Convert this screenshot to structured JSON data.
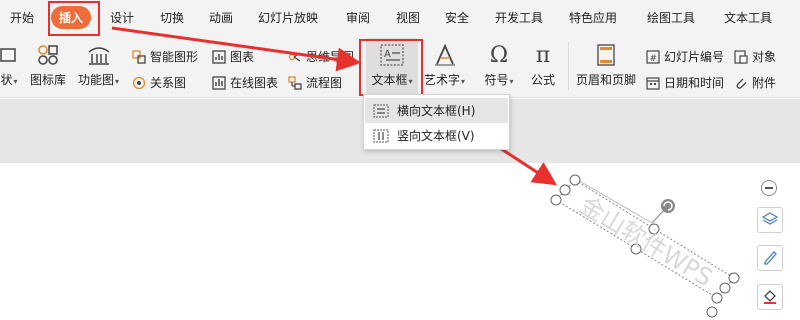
{
  "menu": {
    "tabs": [
      {
        "label": "开始"
      },
      {
        "label": "插入",
        "active": true
      },
      {
        "label": "设计"
      },
      {
        "label": "切换"
      },
      {
        "label": "动画"
      },
      {
        "label": "幻灯片放映"
      },
      {
        "label": "审阅"
      },
      {
        "label": "视图"
      },
      {
        "label": "安全"
      },
      {
        "label": "开发工具"
      },
      {
        "label": "特色应用"
      },
      {
        "label": "绘图工具"
      },
      {
        "label": "文本工具"
      }
    ]
  },
  "ribbon": {
    "partial_label": "状",
    "icon_library": "图标库",
    "function_chart": "功能图",
    "smart_shape": "智能图形",
    "relation_chart": "关系图",
    "chart": "图表",
    "online_chart": "在线图表",
    "mind_map": "思维导图",
    "flowchart": "流程图",
    "textbox": "文本框",
    "wordart": "艺术字",
    "symbol": "符号",
    "formula": "公式",
    "header_footer": "页眉和页脚",
    "slide_number": "幻灯片编号",
    "date_time": "日期和时间",
    "object": "对象",
    "attachment": "附件"
  },
  "dropdown": {
    "items": [
      {
        "label": "横向文本框(H)"
      },
      {
        "label": "竖向文本框(V)"
      }
    ]
  },
  "canvas": {
    "textbox_text": "金山软件WPS"
  },
  "colors": {
    "accent": "#ee6b3a",
    "highlight_red": "#e8312f",
    "ribbon_bg": "#f3f3f3"
  }
}
